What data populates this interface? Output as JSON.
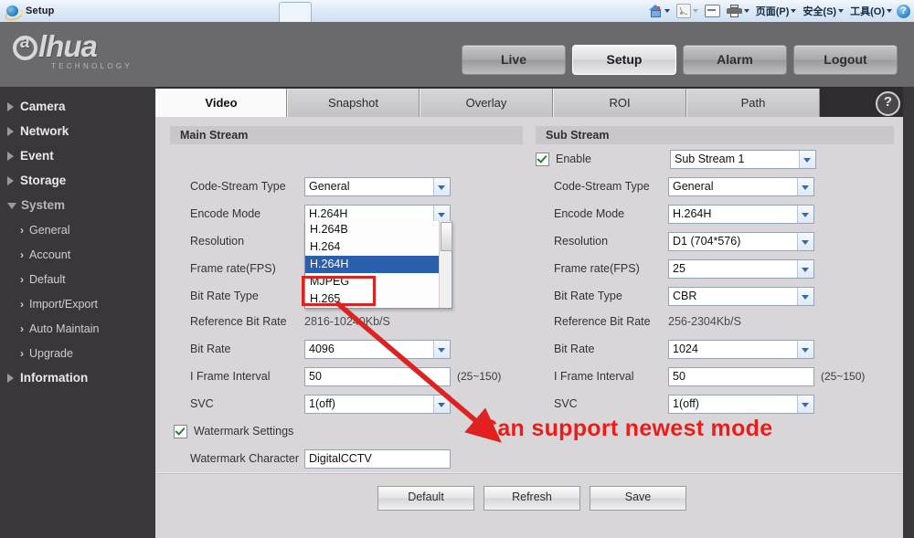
{
  "browser": {
    "title": "Setup",
    "icons": [
      "ie-logo-icon",
      "new-tab-icon"
    ],
    "toolbar": [
      {
        "name": "home-icon",
        "label": ""
      },
      {
        "name": "feeds-icon",
        "label": ""
      },
      {
        "name": "read-mail-icon",
        "label": ""
      },
      {
        "name": "print-icon",
        "label": ""
      },
      {
        "name": "page-menu",
        "label": "页面(P)"
      },
      {
        "name": "safety-menu",
        "label": "安全(S)"
      },
      {
        "name": "tools-menu",
        "label": "工具(O)"
      },
      {
        "name": "help-icon",
        "label": "?"
      }
    ]
  },
  "header": {
    "logo_text": "lhua",
    "logo_sub": "TECHNOLOGY",
    "nav": [
      {
        "label": "Live",
        "active": false
      },
      {
        "label": "Setup",
        "active": true
      },
      {
        "label": "Alarm",
        "active": false
      },
      {
        "label": "Logout",
        "active": false
      }
    ]
  },
  "sidebar": {
    "items": [
      {
        "label": "Camera",
        "expanded": false
      },
      {
        "label": "Network",
        "expanded": false
      },
      {
        "label": "Event",
        "expanded": false
      },
      {
        "label": "Storage",
        "expanded": false
      },
      {
        "label": "System",
        "expanded": true
      },
      {
        "label": "Information",
        "expanded": false
      }
    ],
    "sub_items": [
      {
        "label": "General"
      },
      {
        "label": "Account"
      },
      {
        "label": "Default"
      },
      {
        "label": "Import/Export"
      },
      {
        "label": "Auto Maintain"
      },
      {
        "label": "Upgrade"
      }
    ]
  },
  "tabs": [
    {
      "label": "Video",
      "active": true
    },
    {
      "label": "Snapshot",
      "active": false
    },
    {
      "label": "Overlay",
      "active": false
    },
    {
      "label": "ROI",
      "active": false
    },
    {
      "label": "Path",
      "active": false
    }
  ],
  "help_glyph": "?",
  "main_stream": {
    "title": "Main Stream",
    "code_stream_type": {
      "label": "Code-Stream Type",
      "value": "General"
    },
    "encode_mode": {
      "label": "Encode Mode",
      "value": "H.264H"
    },
    "resolution": {
      "label": "Resolution",
      "value": ""
    },
    "frame_rate": {
      "label": "Frame rate(FPS)",
      "value": ""
    },
    "bit_rate_type": {
      "label": "Bit Rate Type",
      "value": ""
    },
    "reference_bit_rate": {
      "label": "Reference Bit Rate",
      "value": "2816-10240Kb/S"
    },
    "bit_rate": {
      "label": "Bit Rate",
      "value": "4096"
    },
    "i_frame_interval": {
      "label": "I Frame Interval",
      "value": "50",
      "hint": "(25~150)"
    },
    "svc": {
      "label": "SVC",
      "value": "1(off)"
    },
    "watermark_settings": {
      "label": "Watermark Settings",
      "checked": true
    },
    "watermark_character": {
      "label": "Watermark Character",
      "value": "DigitalCCTV"
    }
  },
  "encode_dropdown": {
    "open": true,
    "options": [
      "H.264B",
      "H.264",
      "H.264H",
      "MJPEG",
      "H.265"
    ],
    "selected": "H.264H",
    "highlighted_option": "H.265"
  },
  "sub_stream": {
    "title": "Sub Stream",
    "enable": {
      "label": "Enable",
      "checked": true,
      "value": "Sub Stream 1"
    },
    "code_stream_type": {
      "label": "Code-Stream Type",
      "value": "General"
    },
    "encode_mode": {
      "label": "Encode Mode",
      "value": "H.264H"
    },
    "resolution": {
      "label": "Resolution",
      "value": "D1 (704*576)"
    },
    "frame_rate": {
      "label": "Frame rate(FPS)",
      "value": "25"
    },
    "bit_rate_type": {
      "label": "Bit Rate Type",
      "value": "CBR"
    },
    "reference_bit_rate": {
      "label": "Reference Bit Rate",
      "value": "256-2304Kb/S"
    },
    "bit_rate": {
      "label": "Bit Rate",
      "value": "1024"
    },
    "i_frame_interval": {
      "label": "I Frame Interval",
      "value": "50",
      "hint": "(25~150)"
    },
    "svc": {
      "label": "SVC",
      "value": "1(off)"
    }
  },
  "annotation": {
    "text": "Can support newest mode",
    "color": "#ee1c18"
  },
  "footer": {
    "buttons": [
      {
        "label": "Default"
      },
      {
        "label": "Refresh"
      },
      {
        "label": "Save"
      }
    ]
  },
  "colors": {
    "header_bg": "#6a6a6d",
    "sidebar_bg": "#3a373b",
    "content_bg": "#d8d6d9",
    "panel_header_bg": "#c9c7ca",
    "dropdown_highlight": "#2a5fae",
    "annotation_red": "#ee1c18"
  }
}
